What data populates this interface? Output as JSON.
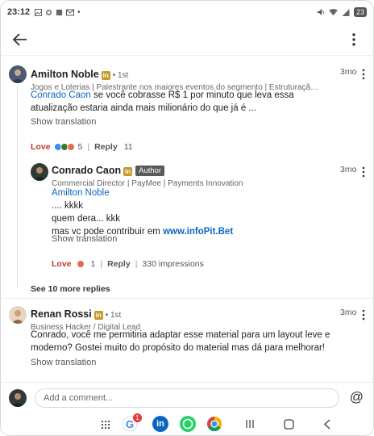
{
  "status": {
    "time": "23:12",
    "battery": "23"
  },
  "comments": [
    {
      "author": "Amilton Noble",
      "degree": "• 1st",
      "headline": "Jogos e Loterias | Palestrante nos maiores eventos do segmento | Estruturação de modelos lotéricos...",
      "time": "3mo",
      "mention": "Conrado Caon",
      "text": " se você cobrasse R$ 1 por minuto que leva essa atualização estaria ainda mais milionário do que já é ...",
      "show_translation": "Show translation",
      "reaction_label": "Love",
      "reaction_count": "5",
      "reply_label": "Reply",
      "reply_count": "11"
    }
  ],
  "reply": {
    "author": "Conrado Caon",
    "author_badge": "Author",
    "headline": "Commercial Director | PayMee | Payments Innovation",
    "time": "3mo",
    "mention": "Amilton Noble",
    "line1": ".... kkkk",
    "line2": "quem dera... kkk",
    "line3_prefix": "mas vc pode contribuir em ",
    "line3_link": "www.infoPit.Bet",
    "show_translation": "Show translation",
    "reaction_label": "Love",
    "reaction_count": "1",
    "reply_label": "Reply",
    "impressions": "330 impressions"
  },
  "see_more": "See 10 more replies",
  "comment2": {
    "author": "Renan Rossi",
    "degree": "• 1st",
    "headline": "Business Hacker / Digital Lead",
    "time": "3mo",
    "text": "Conrado, você me permitiria adaptar esse material para um layout leve e moderno? Gostei muito do propósito do material mas dá para melhorar!",
    "show_translation": "Show translation"
  },
  "compose": {
    "placeholder": "Add a comment..."
  },
  "nav": {
    "google_badge": "1"
  },
  "colors": {
    "accent": "#0a66c2",
    "love": "#c0392b",
    "li_badge": "#c79a2e"
  }
}
